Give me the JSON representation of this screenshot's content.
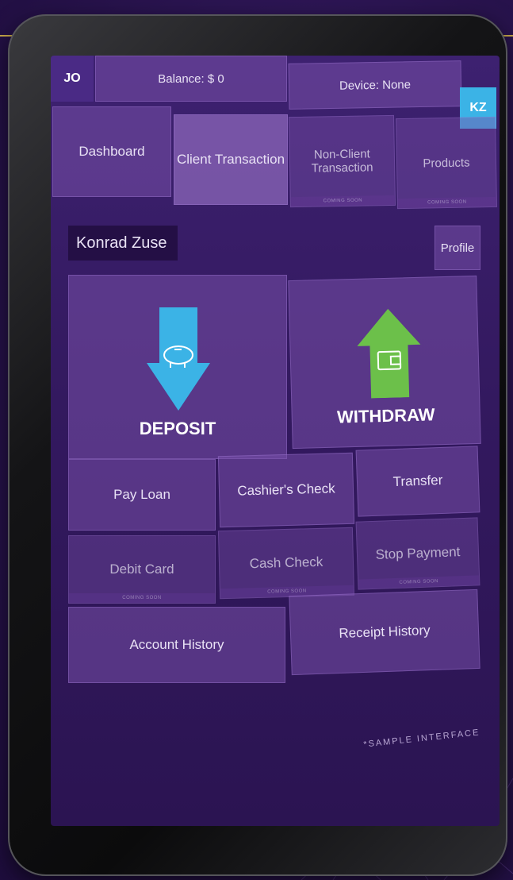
{
  "header": {
    "user_initials": "JO",
    "balance": "Balance: $ 0",
    "device": "Device: None",
    "client_initials": "KZ"
  },
  "tabs": [
    {
      "label": "Dashboard",
      "badge": ""
    },
    {
      "label": "Client Transaction",
      "badge": ""
    },
    {
      "label": "Non-Client\nTransaction",
      "badge": "COMING SOON"
    },
    {
      "label": "Products",
      "badge": "COMING SOON"
    }
  ],
  "client": {
    "name": "Konrad Zuse",
    "profile_label": "Profile"
  },
  "actions": {
    "deposit": "DEPOSIT",
    "withdraw": "WITHDRAW",
    "pay_loan": "Pay Loan",
    "cashiers_check": "Cashier's Check",
    "transfer": "Transfer",
    "debit_card": "Debit Card",
    "debit_card_badge": "COMING SOON",
    "cash_check": "Cash Check",
    "cash_check_badge": "COMING SOON",
    "stop_payment": "Stop Payment",
    "stop_payment_badge": "COMING SOON",
    "account_history": "Account History",
    "receipt_history": "Receipt History"
  },
  "watermark": "*SAMPLE INTERFACE",
  "colors": {
    "accent_blue": "#3bb3e6",
    "accent_green": "#6cc04a",
    "background": "#2a1450",
    "tile": "#7a50aa",
    "gold": "#c8a84a"
  },
  "icons": [
    "piggy-bank-icon",
    "wallet-icon",
    "arrow-down-icon",
    "arrow-up-icon"
  ]
}
